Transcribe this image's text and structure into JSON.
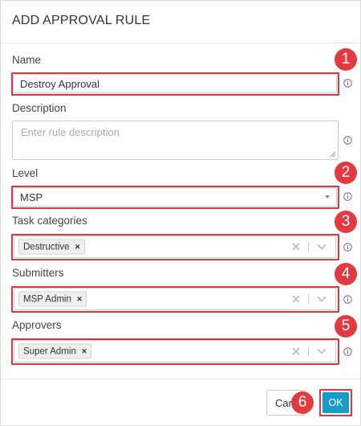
{
  "dialog": {
    "title": "ADD APPROVAL RULE"
  },
  "fields": {
    "name": {
      "label": "Name",
      "value": "Destroy Approval"
    },
    "description": {
      "label": "Description",
      "placeholder": "Enter rule description",
      "value": ""
    },
    "level": {
      "label": "Level",
      "value": "MSP"
    },
    "task_categories": {
      "label": "Task categories",
      "tags": [
        "Destructive"
      ]
    },
    "submitters": {
      "label": "Submitters",
      "tags": [
        "MSP Admin"
      ]
    },
    "approvers": {
      "label": "Approvers",
      "tags": [
        "Super Admin"
      ]
    }
  },
  "buttons": {
    "cancel_label": "Cancel",
    "ok_label": "OK"
  },
  "annotations": [
    "1",
    "2",
    "3",
    "4",
    "5",
    "6"
  ],
  "colors": {
    "highlight": "#e0373f",
    "badge": "#e23a3f",
    "ok_button": "#1a9bc7"
  },
  "icons": {
    "info": "info-icon",
    "caret": "caret-down-icon",
    "clear": "clear-icon",
    "dropdown": "chevron-down-icon",
    "tag_remove": "tag-remove-icon"
  }
}
